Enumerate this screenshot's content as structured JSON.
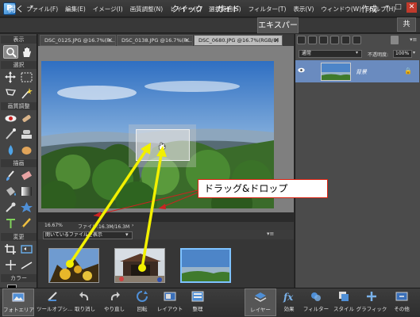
{
  "menu": {
    "items": [
      "ファイル(F)",
      "編集(E)",
      "イメージ(I)",
      "画質調整(N)",
      "レイヤー(L)",
      "選択範囲(S)",
      "フィルター(T)",
      "表示(V)",
      "ウィンドウ(W)",
      "ヘルプ(H)"
    ]
  },
  "window_controls": {
    "minimize": "–",
    "maximize": "□",
    "close": "✕"
  },
  "modebar": {
    "open_label": "開く",
    "quick_label": "クイック",
    "guided_label": "ガイド",
    "expert_label": "エキスパート",
    "create_label": "作成",
    "share_label": "共"
  },
  "tools": {
    "section_view": "表示",
    "section_select": "選択",
    "section_enhance": "画質調整",
    "section_draw": "描画",
    "section_modify": "変更",
    "section_color": "カラー"
  },
  "tabs": [
    {
      "label": "DSC_0125.JPG @16.7%(R...",
      "close": "×"
    },
    {
      "label": "DSC_0138.JPG @16.7%(R...",
      "close": "×"
    },
    {
      "label": "DSC_0680.JPG @16.7%(RGB/8)",
      "close": "×"
    }
  ],
  "status": {
    "zoom": "16.67%",
    "file": "ファイル:16.3M/16.3M",
    "arrow": "›"
  },
  "bin": {
    "dropdown_value": "開いているファイルを表示",
    "caret": "▾",
    "menu": "▾≡"
  },
  "layers": {
    "blend_mode": "通常",
    "opacity_label": "不透明度:",
    "opacity_value": "100%",
    "layer_name": "背景",
    "menu": "▾≡",
    "caret": "▾"
  },
  "callout": {
    "text": "ドラッグ&ドロップ"
  },
  "bottom_left": [
    {
      "label": "フォトエリア"
    },
    {
      "label": "ツールオプシ..."
    },
    {
      "label": "取り消し"
    },
    {
      "label": "やり直し"
    },
    {
      "label": "回転"
    },
    {
      "label": "レイアウト"
    },
    {
      "label": "整理"
    }
  ],
  "bottom_right": [
    {
      "label": "レイヤー"
    },
    {
      "label": "効果"
    },
    {
      "label": "フィルター"
    },
    {
      "label": "スタイル"
    },
    {
      "label": "グラフィック"
    },
    {
      "label": "その他"
    }
  ],
  "colors": {
    "accent": "#7ec2ff",
    "callout_border": "#d21",
    "arrow": "#f2f000",
    "selected_layer": "#6a8bbf"
  }
}
